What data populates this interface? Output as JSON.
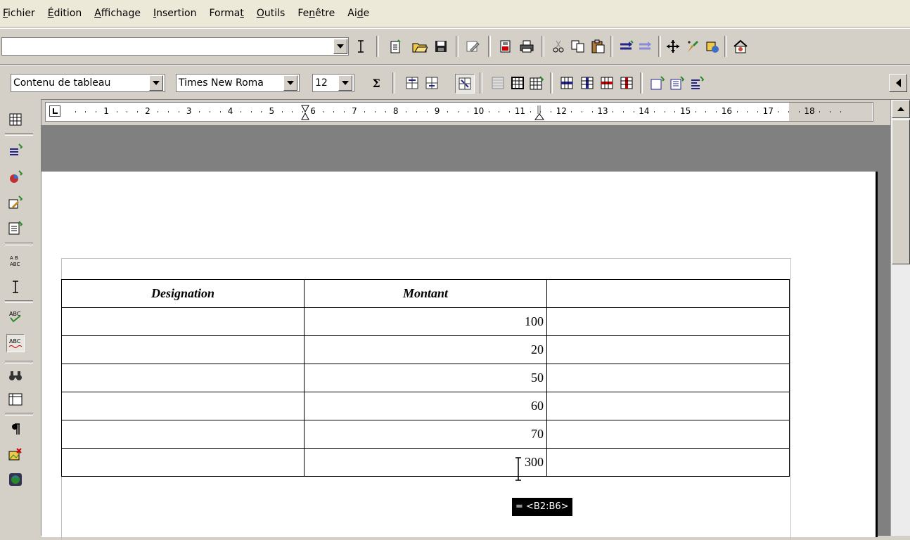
{
  "menu": [
    {
      "pre": "",
      "u": "F",
      "post": "ichier"
    },
    {
      "pre": "",
      "u": "É",
      "post": "dition"
    },
    {
      "pre": "",
      "u": "A",
      "post": "ffichage"
    },
    {
      "pre": "",
      "u": "I",
      "post": "nsertion"
    },
    {
      "pre": "Forma",
      "u": "t",
      "post": ""
    },
    {
      "pre": "",
      "u": "O",
      "post": "utils"
    },
    {
      "pre": "Fe",
      "u": "n",
      "post": "être"
    },
    {
      "pre": "Ai",
      "u": "d",
      "post": "e"
    }
  ],
  "toolbar1": {
    "url_value": ""
  },
  "toolbar2": {
    "paragraph_style": "Contenu de tableau",
    "font_name": "Times New Roma",
    "font_size": "12",
    "sum_symbol": "Σ"
  },
  "ruler": {
    "labels": [
      "1",
      "2",
      "3",
      "4",
      "5",
      "6",
      "7",
      "8",
      "9",
      "10",
      "11",
      "12",
      "13",
      "14",
      "15",
      "16",
      "17",
      "18"
    ]
  },
  "table": {
    "headers": [
      "Designation",
      "Montant",
      ""
    ],
    "rows": [
      [
        "",
        "100",
        ""
      ],
      [
        "",
        "20",
        ""
      ],
      [
        "",
        "50",
        ""
      ],
      [
        "",
        "60",
        ""
      ],
      [
        "",
        "70",
        ""
      ],
      [
        "",
        "300",
        ""
      ]
    ]
  },
  "formula_tooltip": "= <B2:B6>",
  "colors": {
    "workspace": "#808080",
    "chrome": "#d4d0c8",
    "menubar": "#ece9d8"
  }
}
